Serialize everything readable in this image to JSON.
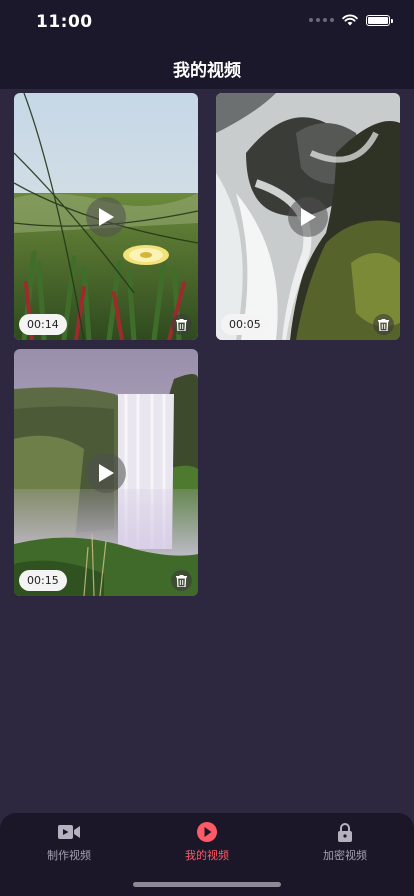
{
  "status": {
    "time": "11:00"
  },
  "header": {
    "title": "我的视频"
  },
  "videos": [
    {
      "duration": "00:14",
      "icon": "play-icon",
      "delete_icon": "trash-icon"
    },
    {
      "duration": "00:05",
      "icon": "play-icon",
      "delete_icon": "trash-icon"
    },
    {
      "duration": "00:15",
      "icon": "play-icon",
      "delete_icon": "trash-icon"
    }
  ],
  "tabs": [
    {
      "label": "制作视频",
      "icon": "video-camera-icon",
      "active": false
    },
    {
      "label": "我的视频",
      "icon": "play-circle-icon",
      "active": true
    },
    {
      "label": "加密视频",
      "icon": "lock-icon",
      "active": false
    }
  ],
  "colors": {
    "accent": "#ff5a66",
    "background": "#2d2740",
    "bar": "#1c182b"
  }
}
